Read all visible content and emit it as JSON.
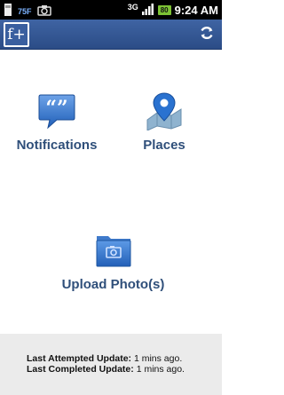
{
  "status_bar": {
    "temperature": "75F",
    "network": "3G",
    "battery": "80",
    "time": "9:24 AM"
  },
  "header": {
    "logo_text": "f+",
    "refresh_icon": "refresh-icon",
    "colors": {
      "bar": "#3a5f9f",
      "logo_bg": "#ffffff"
    }
  },
  "tiles": {
    "notifications": {
      "label": "Notifications",
      "icon": "speech-bubble-icon"
    },
    "places": {
      "label": "Places",
      "icon": "map-pin-icon"
    },
    "upload": {
      "label": "Upload Photo(s)",
      "icon": "folder-camera-icon"
    }
  },
  "footer": {
    "attempted_label": "Last Attempted Update:",
    "attempted_value": "1 mins ago.",
    "completed_label": "Last Completed Update:",
    "completed_value": "1 mins ago."
  }
}
